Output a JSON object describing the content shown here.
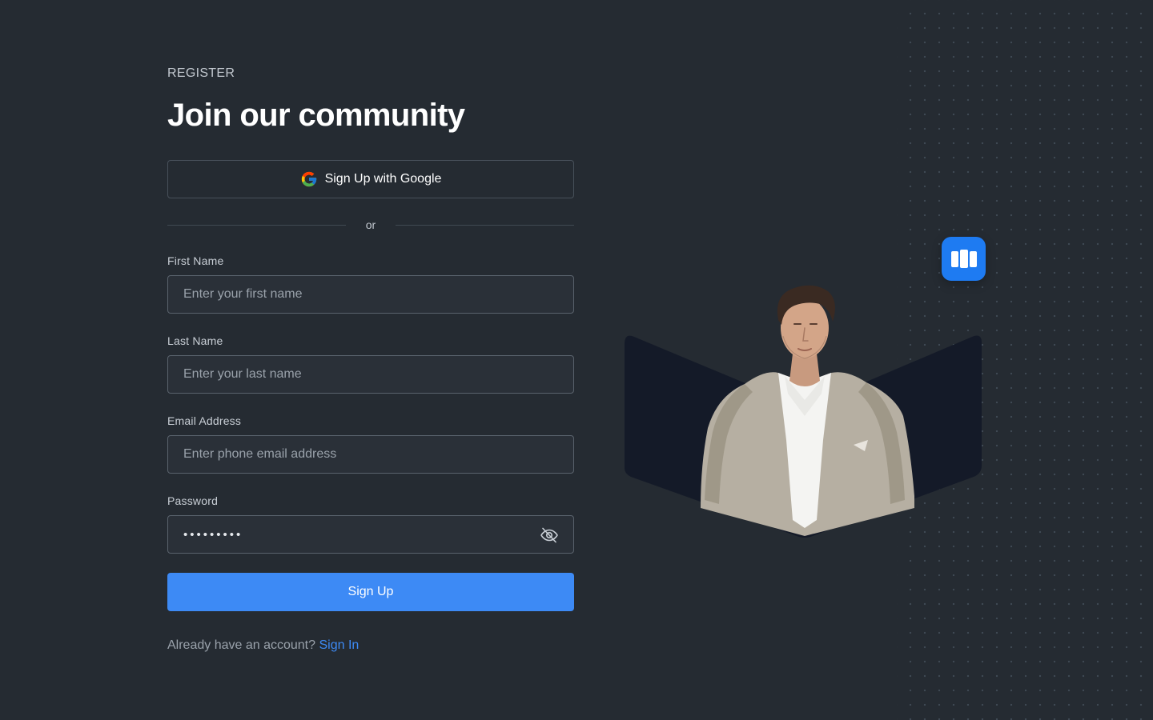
{
  "header": {
    "eyebrow": "REGISTER",
    "title": "Join our community"
  },
  "google": {
    "label": "Sign Up with Google",
    "icon": "google-icon"
  },
  "divider": {
    "label": "or"
  },
  "fields": {
    "first_name": {
      "label": "First Name",
      "placeholder": "Enter your first name",
      "value": ""
    },
    "last_name": {
      "label": "Last Name",
      "placeholder": "Enter your last name",
      "value": ""
    },
    "email": {
      "label": "Email Address",
      "placeholder": "Enter phone email address",
      "value": ""
    },
    "password": {
      "label": "Password",
      "value": "password1",
      "visibility_icon": "eye-off-icon"
    }
  },
  "actions": {
    "signup_label": "Sign Up",
    "signin_prompt": "Already have an account?",
    "signin_link": "Sign In"
  },
  "colors": {
    "background": "#252b32",
    "accent": "#3d8af5",
    "field_border": "#5a636d",
    "hero_panel": "#141a28",
    "app_icon": "#1e7bf2"
  },
  "hero": {
    "app_icon": "book-icon",
    "image": "man-in-blazer-portrait"
  }
}
